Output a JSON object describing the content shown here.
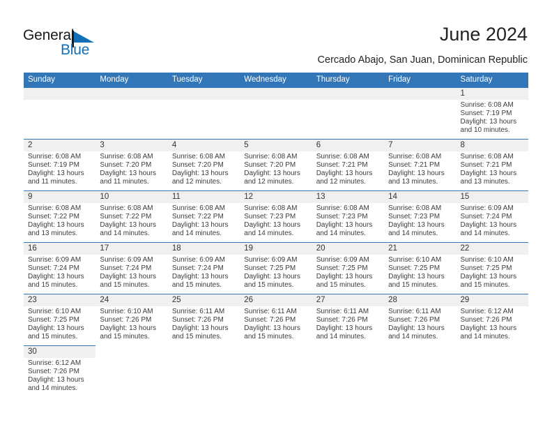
{
  "brand": {
    "name_part1": "General",
    "name_part2": "Blue",
    "flag_icon": "blue-triangle-flag",
    "color_dark": "#1a1a1a",
    "color_blue": "#1270b8"
  },
  "header": {
    "month_title": "June 2024",
    "location": "Cercado Abajo, San Juan, Dominican Republic"
  },
  "theme": {
    "header_blue": "#3276b8",
    "daynum_band": "#f0f0f0",
    "text": "#3b3b3b"
  },
  "weekday_headers": [
    "Sunday",
    "Monday",
    "Tuesday",
    "Wednesday",
    "Thursday",
    "Friday",
    "Saturday"
  ],
  "labels": {
    "sunrise_prefix": "Sunrise:",
    "sunset_prefix": "Sunset:",
    "daylight_prefix": "Daylight:"
  },
  "weeks": [
    [
      {
        "empty": true
      },
      {
        "empty": true
      },
      {
        "empty": true
      },
      {
        "empty": true
      },
      {
        "empty": true
      },
      {
        "empty": true
      },
      {
        "day": "1",
        "sunrise": "Sunrise: 6:08 AM",
        "sunset": "Sunset: 7:19 PM",
        "daylight_l1": "Daylight: 13 hours",
        "daylight_l2": "and 10 minutes."
      }
    ],
    [
      {
        "day": "2",
        "sunrise": "Sunrise: 6:08 AM",
        "sunset": "Sunset: 7:19 PM",
        "daylight_l1": "Daylight: 13 hours",
        "daylight_l2": "and 11 minutes."
      },
      {
        "day": "3",
        "sunrise": "Sunrise: 6:08 AM",
        "sunset": "Sunset: 7:20 PM",
        "daylight_l1": "Daylight: 13 hours",
        "daylight_l2": "and 11 minutes."
      },
      {
        "day": "4",
        "sunrise": "Sunrise: 6:08 AM",
        "sunset": "Sunset: 7:20 PM",
        "daylight_l1": "Daylight: 13 hours",
        "daylight_l2": "and 12 minutes."
      },
      {
        "day": "5",
        "sunrise": "Sunrise: 6:08 AM",
        "sunset": "Sunset: 7:20 PM",
        "daylight_l1": "Daylight: 13 hours",
        "daylight_l2": "and 12 minutes."
      },
      {
        "day": "6",
        "sunrise": "Sunrise: 6:08 AM",
        "sunset": "Sunset: 7:21 PM",
        "daylight_l1": "Daylight: 13 hours",
        "daylight_l2": "and 12 minutes."
      },
      {
        "day": "7",
        "sunrise": "Sunrise: 6:08 AM",
        "sunset": "Sunset: 7:21 PM",
        "daylight_l1": "Daylight: 13 hours",
        "daylight_l2": "and 13 minutes."
      },
      {
        "day": "8",
        "sunrise": "Sunrise: 6:08 AM",
        "sunset": "Sunset: 7:21 PM",
        "daylight_l1": "Daylight: 13 hours",
        "daylight_l2": "and 13 minutes."
      }
    ],
    [
      {
        "day": "9",
        "sunrise": "Sunrise: 6:08 AM",
        "sunset": "Sunset: 7:22 PM",
        "daylight_l1": "Daylight: 13 hours",
        "daylight_l2": "and 13 minutes."
      },
      {
        "day": "10",
        "sunrise": "Sunrise: 6:08 AM",
        "sunset": "Sunset: 7:22 PM",
        "daylight_l1": "Daylight: 13 hours",
        "daylight_l2": "and 14 minutes."
      },
      {
        "day": "11",
        "sunrise": "Sunrise: 6:08 AM",
        "sunset": "Sunset: 7:22 PM",
        "daylight_l1": "Daylight: 13 hours",
        "daylight_l2": "and 14 minutes."
      },
      {
        "day": "12",
        "sunrise": "Sunrise: 6:08 AM",
        "sunset": "Sunset: 7:23 PM",
        "daylight_l1": "Daylight: 13 hours",
        "daylight_l2": "and 14 minutes."
      },
      {
        "day": "13",
        "sunrise": "Sunrise: 6:08 AM",
        "sunset": "Sunset: 7:23 PM",
        "daylight_l1": "Daylight: 13 hours",
        "daylight_l2": "and 14 minutes."
      },
      {
        "day": "14",
        "sunrise": "Sunrise: 6:08 AM",
        "sunset": "Sunset: 7:23 PM",
        "daylight_l1": "Daylight: 13 hours",
        "daylight_l2": "and 14 minutes."
      },
      {
        "day": "15",
        "sunrise": "Sunrise: 6:09 AM",
        "sunset": "Sunset: 7:24 PM",
        "daylight_l1": "Daylight: 13 hours",
        "daylight_l2": "and 14 minutes."
      }
    ],
    [
      {
        "day": "16",
        "sunrise": "Sunrise: 6:09 AM",
        "sunset": "Sunset: 7:24 PM",
        "daylight_l1": "Daylight: 13 hours",
        "daylight_l2": "and 15 minutes."
      },
      {
        "day": "17",
        "sunrise": "Sunrise: 6:09 AM",
        "sunset": "Sunset: 7:24 PM",
        "daylight_l1": "Daylight: 13 hours",
        "daylight_l2": "and 15 minutes."
      },
      {
        "day": "18",
        "sunrise": "Sunrise: 6:09 AM",
        "sunset": "Sunset: 7:24 PM",
        "daylight_l1": "Daylight: 13 hours",
        "daylight_l2": "and 15 minutes."
      },
      {
        "day": "19",
        "sunrise": "Sunrise: 6:09 AM",
        "sunset": "Sunset: 7:25 PM",
        "daylight_l1": "Daylight: 13 hours",
        "daylight_l2": "and 15 minutes."
      },
      {
        "day": "20",
        "sunrise": "Sunrise: 6:09 AM",
        "sunset": "Sunset: 7:25 PM",
        "daylight_l1": "Daylight: 13 hours",
        "daylight_l2": "and 15 minutes."
      },
      {
        "day": "21",
        "sunrise": "Sunrise: 6:10 AM",
        "sunset": "Sunset: 7:25 PM",
        "daylight_l1": "Daylight: 13 hours",
        "daylight_l2": "and 15 minutes."
      },
      {
        "day": "22",
        "sunrise": "Sunrise: 6:10 AM",
        "sunset": "Sunset: 7:25 PM",
        "daylight_l1": "Daylight: 13 hours",
        "daylight_l2": "and 15 minutes."
      }
    ],
    [
      {
        "day": "23",
        "sunrise": "Sunrise: 6:10 AM",
        "sunset": "Sunset: 7:25 PM",
        "daylight_l1": "Daylight: 13 hours",
        "daylight_l2": "and 15 minutes."
      },
      {
        "day": "24",
        "sunrise": "Sunrise: 6:10 AM",
        "sunset": "Sunset: 7:26 PM",
        "daylight_l1": "Daylight: 13 hours",
        "daylight_l2": "and 15 minutes."
      },
      {
        "day": "25",
        "sunrise": "Sunrise: 6:11 AM",
        "sunset": "Sunset: 7:26 PM",
        "daylight_l1": "Daylight: 13 hours",
        "daylight_l2": "and 15 minutes."
      },
      {
        "day": "26",
        "sunrise": "Sunrise: 6:11 AM",
        "sunset": "Sunset: 7:26 PM",
        "daylight_l1": "Daylight: 13 hours",
        "daylight_l2": "and 15 minutes."
      },
      {
        "day": "27",
        "sunrise": "Sunrise: 6:11 AM",
        "sunset": "Sunset: 7:26 PM",
        "daylight_l1": "Daylight: 13 hours",
        "daylight_l2": "and 14 minutes."
      },
      {
        "day": "28",
        "sunrise": "Sunrise: 6:11 AM",
        "sunset": "Sunset: 7:26 PM",
        "daylight_l1": "Daylight: 13 hours",
        "daylight_l2": "and 14 minutes."
      },
      {
        "day": "29",
        "sunrise": "Sunrise: 6:12 AM",
        "sunset": "Sunset: 7:26 PM",
        "daylight_l1": "Daylight: 13 hours",
        "daylight_l2": "and 14 minutes."
      }
    ],
    [
      {
        "day": "30",
        "sunrise": "Sunrise: 6:12 AM",
        "sunset": "Sunset: 7:26 PM",
        "daylight_l1": "Daylight: 13 hours",
        "daylight_l2": "and 14 minutes."
      },
      {
        "blank": true
      },
      {
        "blank": true
      },
      {
        "blank": true
      },
      {
        "blank": true
      },
      {
        "blank": true
      },
      {
        "blank": true
      }
    ]
  ]
}
